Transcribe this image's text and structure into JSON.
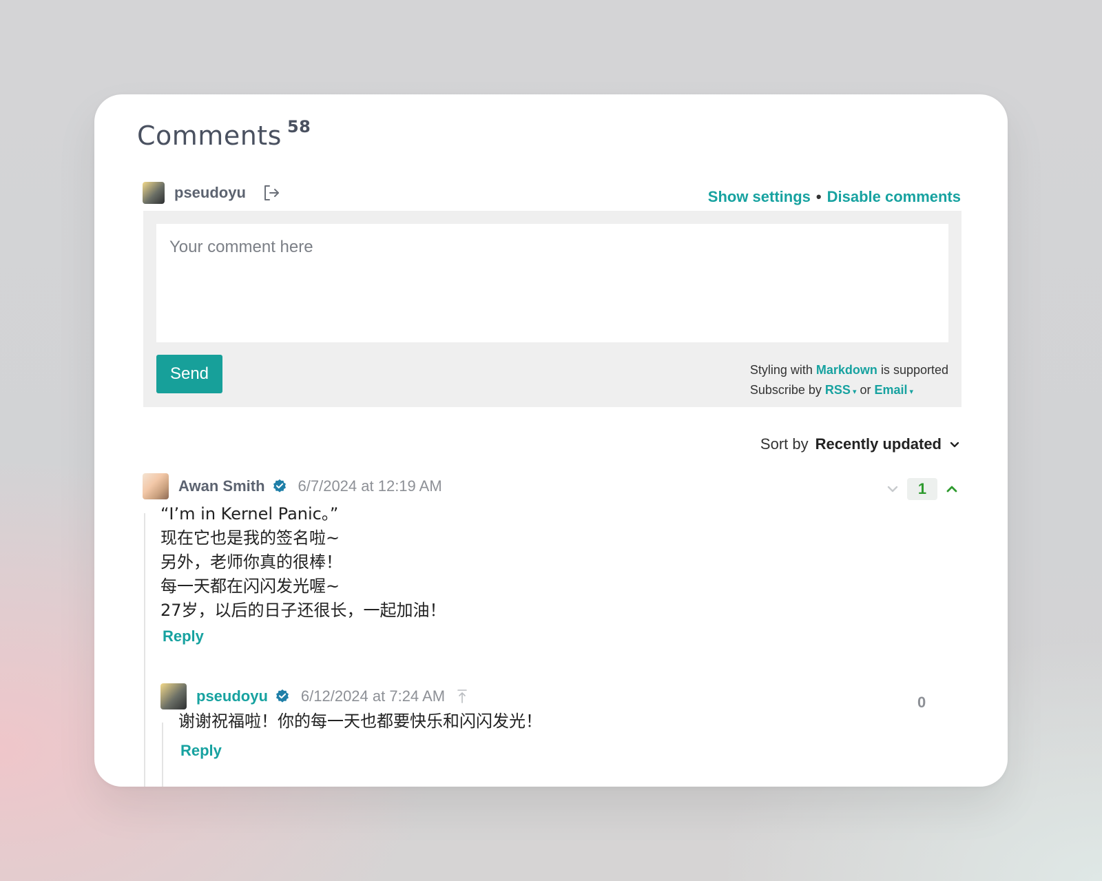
{
  "header": {
    "title": "Comments",
    "count": "58"
  },
  "current_user": {
    "name": "pseudoyu"
  },
  "top_links": {
    "show_settings": "Show settings",
    "separator": "•",
    "disable_comments": "Disable comments"
  },
  "composer": {
    "placeholder": "Your comment here",
    "value": "",
    "send_label": "Send",
    "styling_prefix": "Styling with",
    "markdown_link": "Markdown",
    "styling_suffix": "is supported",
    "subscribe_prefix": "Subscribe by",
    "rss_link": "RSS",
    "or_text": "or",
    "email_link": "Email"
  },
  "sort": {
    "label": "Sort by",
    "value": "Recently updated"
  },
  "comments": [
    {
      "author": "Awan Smith",
      "date": "6/7/2024 at 12:19 AM",
      "lines": [
        "“I’m in Kernel Panic。”",
        "现在它也是我的签名啦~",
        "另外，老师你真的很棒！",
        "每一天都在闪闪发光喔~",
        "27岁，以后的日子还很长，一起加油！"
      ],
      "votes": "1",
      "reply_label": "Reply",
      "replies": [
        {
          "author": "pseudoyu",
          "date": "6/12/2024 at 7:24 AM",
          "lines": [
            "谢谢祝福啦！你的每一天也都要快乐和闪闪发光！"
          ],
          "votes": "0",
          "reply_label": "Reply"
        }
      ]
    }
  ],
  "colors": {
    "accent": "#17a2a0",
    "send_button": "#17a09a",
    "verified_badge": "#1f7fa8",
    "upvote_active": "#2e9a2e"
  },
  "icons": {
    "logout": "logout-icon",
    "verified": "verified-badge-icon",
    "sort_chevron": "chevron-down-icon",
    "downvote": "chevron-down-icon",
    "upvote": "chevron-up-icon",
    "go_to_parent": "arrow-up-to-top-icon"
  }
}
